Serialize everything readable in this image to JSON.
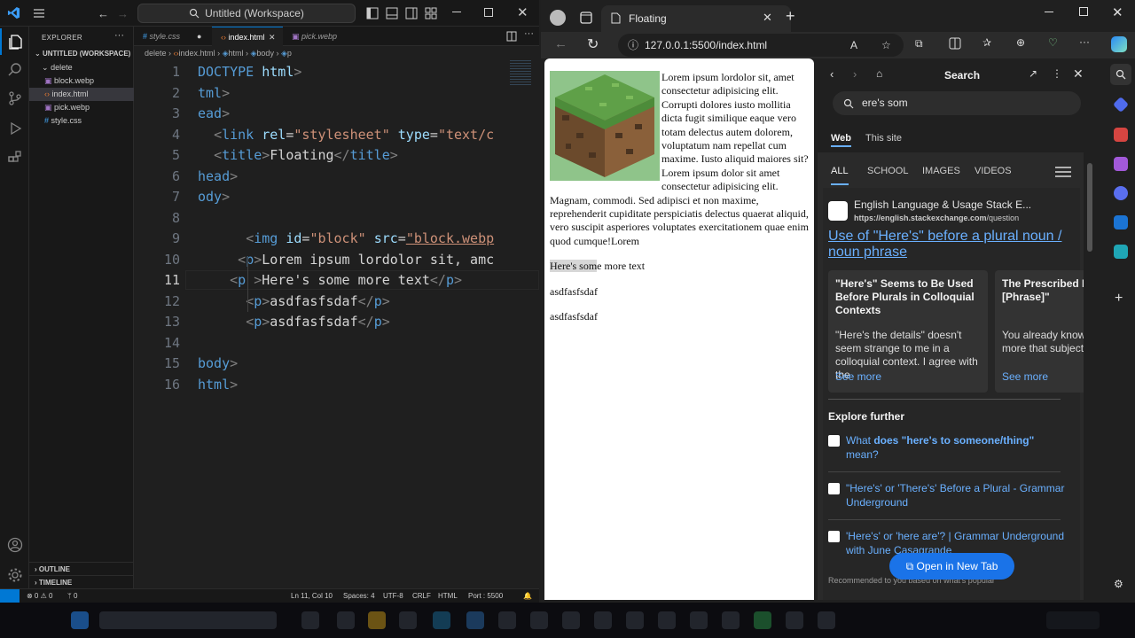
{
  "vscode": {
    "title": "Untitled (Workspace)",
    "explorer": {
      "header": "EXPLORER",
      "workspace": "UNTITLED (WORKSPACE)",
      "folder": "delete",
      "files": [
        "block.webp",
        "index.html",
        "pick.webp",
        "style.css"
      ],
      "outline": "OUTLINE",
      "timeline": "TIMELINE"
    },
    "tabs": [
      {
        "label": "style.css"
      },
      {
        "label": "index.html"
      },
      {
        "label": "pick.webp"
      }
    ],
    "breadcrumb": [
      "delete",
      "index.html",
      "html",
      "body",
      "p"
    ],
    "lines": [
      {
        "n": "1",
        "cur": false,
        "html": "<span class=\"tg\">DOCTYPE</span> <span class=\"at\">html</span><span class=\"br\">&gt;</span>"
      },
      {
        "n": "2",
        "cur": false,
        "html": "<span class=\"tg\">tml</span><span class=\"br\">&gt;</span>"
      },
      {
        "n": "3",
        "cur": false,
        "html": "<span class=\"tg\">ead</span><span class=\"br\">&gt;</span>"
      },
      {
        "n": "4",
        "cur": false,
        "html": "  <span class=\"br\">&lt;</span><span class=\"tg\">link</span> <span class=\"at\">rel</span>=<span class=\"st\">\"stylesheet\"</span> <span class=\"at\">type</span>=<span class=\"st\">\"text/c</span>"
      },
      {
        "n": "5",
        "cur": false,
        "html": "  <span class=\"br\">&lt;</span><span class=\"tg\">title</span><span class=\"br\">&gt;</span><span class=\"tx\">Floating</span><span class=\"br\">&lt;/</span><span class=\"tg\">title</span><span class=\"br\">&gt;</span>"
      },
      {
        "n": "6",
        "cur": false,
        "html": "<span class=\"tg\">head</span><span class=\"br\">&gt;</span>"
      },
      {
        "n": "7",
        "cur": false,
        "html": "<span class=\"tg\">ody</span><span class=\"br\">&gt;</span>"
      },
      {
        "n": "8",
        "cur": false,
        "html": ""
      },
      {
        "n": "9",
        "cur": false,
        "html": "      <span class=\"br\">&lt;</span><span class=\"tg\">img</span> <span class=\"at\">id</span>=<span class=\"st\">\"block\"</span> <span class=\"at\">src</span>=<span class=\"st\"><u>\"block.webp</u></span>"
      },
      {
        "n": "10",
        "cur": false,
        "html": "     <span class=\"br\">&lt;</span><span class=\"tg\">p</span><span class=\"br\">&gt;</span><span class=\"tx\">Lorem ipsum lordolor sit, amc</span>"
      },
      {
        "n": "11",
        "cur": true,
        "html": "    <span class=\"br\">&lt;</span><span class=\"tg\">p</span> <span class=\"br\">&gt;</span><span class=\"tx\">Here's some more text</span><span class=\"br\">&lt;/</span><span class=\"tg\">p</span><span class=\"br\">&gt;</span>"
      },
      {
        "n": "12",
        "cur": false,
        "html": "      <span class=\"br\">&lt;</span><span class=\"tg\">p</span><span class=\"br\">&gt;</span><span class=\"tx\">asdfasfsdaf</span><span class=\"br\">&lt;/</span><span class=\"tg\">p</span><span class=\"br\">&gt;</span>"
      },
      {
        "n": "13",
        "cur": false,
        "html": "      <span class=\"br\">&lt;</span><span class=\"tg\">p</span><span class=\"br\">&gt;</span><span class=\"tx\">asdfasfsdaf</span><span class=\"br\">&lt;/</span><span class=\"tg\">p</span><span class=\"br\">&gt;</span>"
      },
      {
        "n": "14",
        "cur": false,
        "html": ""
      },
      {
        "n": "15",
        "cur": false,
        "html": "<span class=\"tg\">body</span><span class=\"br\">&gt;</span>"
      },
      {
        "n": "16",
        "cur": false,
        "html": "<span class=\"tg\">html</span><span class=\"br\">&gt;</span>"
      }
    ],
    "status": {
      "problems": "⊗ 0 ⚠ 0",
      "ports": "ᛘ 0",
      "position": "Ln 11, Col 10",
      "spaces": "Spaces: 4",
      "encoding": "UTF-8",
      "eol": "CRLF",
      "language": "HTML",
      "port": "Port : 5500"
    }
  },
  "browser": {
    "tab_title": "Floating",
    "url": "127.0.0.1:5500/index.html",
    "page": {
      "lorem": "Lorem ipsum lordolor sit, amet consectetur adipisicing elit. Corrupti dolores iusto mollitia dicta fugit similique eaque vero totam delectus autem dolorem, voluptatum nam repellat cum maxime. Iusto aliquid maiores sit?Lorem ipsum dolor sit amet consectetur adipisicing elit. Magnam, commodi. Sed adipisci et non maxime, reprehenderit cupiditate perspiciatis delectus quaerat aliquid, vero suscipit asperiores voluptates exercitationem quae enim quod cumque!Lorem",
      "more_text_highlight": "Here's som",
      "more_text_rest": "e more text",
      "line2": "asdfasfsdaf",
      "line3": "asdfasfsdaf"
    },
    "sidebar": {
      "title": "Search",
      "query": "ere's som",
      "scope_tabs": [
        "Web",
        "This site"
      ],
      "result_tabs": [
        "ALL",
        "SCHOOL",
        "IMAGES",
        "VIDEOS"
      ],
      "source_name": "English Language & Usage Stack E...",
      "source_url_bold": "https://english.stackexchange.com",
      "source_url_rest": "/question",
      "result_title": "Use of \"Here's\" before a plural noun / noun phrase",
      "cards": [
        {
          "title": "\"Here's\" Seems to Be Used Before Plurals in Colloquial Contexts",
          "desc": "\"Here's the details\" doesn't seem strange to me in a colloquial context. I agree with the",
          "more": "See more"
        },
        {
          "title": "The Prescribed Is \"Here Are [Phrase]\"",
          "desc": "You already know there's much more that subject. C",
          "more": "See more"
        }
      ],
      "explore_title": "Explore further",
      "explore": [
        {
          "pre": "What ",
          "bold": "does \"here's to someone/thing\"",
          "post": " mean?"
        },
        {
          "pre": "\"Here's' or 'There's' Before a Plural - Grammar Underground",
          "bold": "",
          "post": ""
        },
        {
          "pre": "'Here's' or 'here are'? | Grammar Underground with June Casagrande",
          "bold": "",
          "post": ""
        }
      ],
      "open_new_tab": "Open in New Tab",
      "recommended": "Recommended to you based on what's popular"
    }
  },
  "colors": {
    "vsc_accent": "#0078d4",
    "link_blue": "#6ab0ff",
    "html_tag": "#569cd6",
    "html_attr": "#9cdcfe",
    "html_string": "#ce9178"
  }
}
